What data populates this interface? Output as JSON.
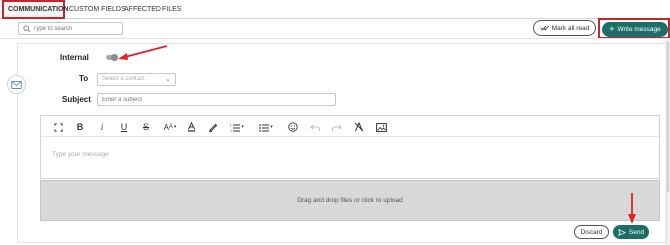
{
  "tabs": [
    {
      "label": "COMMUNICATION",
      "active": true
    },
    {
      "label": "CUSTOM FIELDS",
      "active": false
    },
    {
      "label": "AFFECTED",
      "active": false
    },
    {
      "label": "FILES",
      "active": false
    }
  ],
  "search": {
    "placeholder": "Type to search"
  },
  "actions": {
    "mark_all_read": "Mark all read",
    "write_message": "Write message"
  },
  "form": {
    "internal_label": "Internal",
    "internal_on": false,
    "to_label": "To",
    "to_placeholder": "Select a contact",
    "subject_label": "Subject",
    "subject_placeholder": "Enter a subject"
  },
  "editor": {
    "placeholder": "Type your message",
    "toolbar": [
      "fullscreen-icon",
      "bold",
      "italic",
      "underline",
      "strikethrough",
      "font-size",
      "font-color",
      "highlight",
      "numbered-list",
      "bulleted-list",
      "emoji",
      "undo",
      "redo",
      "clear-format",
      "image"
    ]
  },
  "dropzone": {
    "text": "Drag and drop files or click to upload"
  },
  "footer": {
    "discard": "Discard",
    "send": "Send"
  },
  "colors": {
    "accent": "#1c6e67",
    "highlight_border": "#c4262e",
    "annotation_arrow": "#e3222a"
  }
}
